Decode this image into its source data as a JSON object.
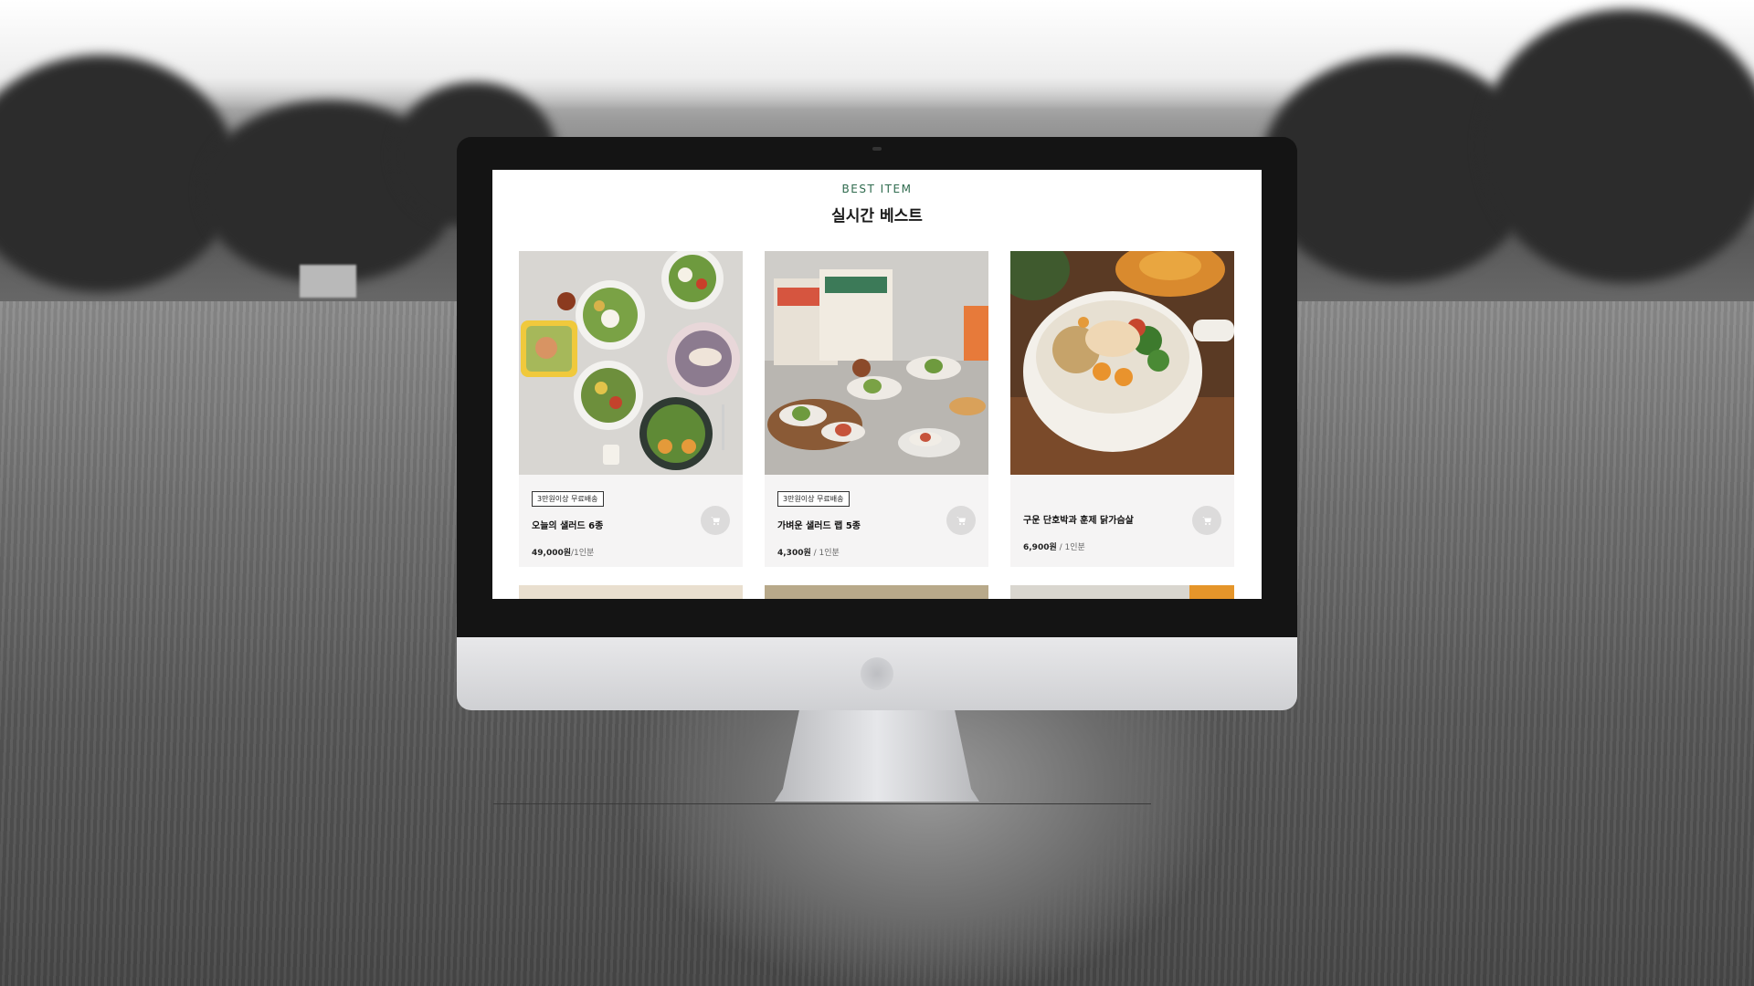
{
  "screen": {
    "eyebrow": "BEST ITEM",
    "title": "실시간 베스트"
  },
  "products": [
    {
      "badge": "3만원이상 무료배송",
      "name": "오늘의 샐러드 6종",
      "price": "49,000원",
      "unit": "/1인분",
      "image": "salad-platter-photo"
    },
    {
      "badge": "3만원이상 무료배송",
      "name": "가벼운 샐러드 랩 5종",
      "price": "4,300원",
      "unit": " / 1인분",
      "image": "salad-wrap-photo"
    },
    {
      "badge": "",
      "name": "구운 단호박과 훈제 닭가슴살",
      "price": "6,900원",
      "unit": " / 1인분",
      "image": "pumpkin-chicken-bowl-photo"
    }
  ],
  "colors": {
    "accent_green": "#2f6b4e",
    "card_bg": "#f5f4f4",
    "cart_button": "#dcdbdb"
  },
  "icons": {
    "cart": "cart-icon"
  }
}
